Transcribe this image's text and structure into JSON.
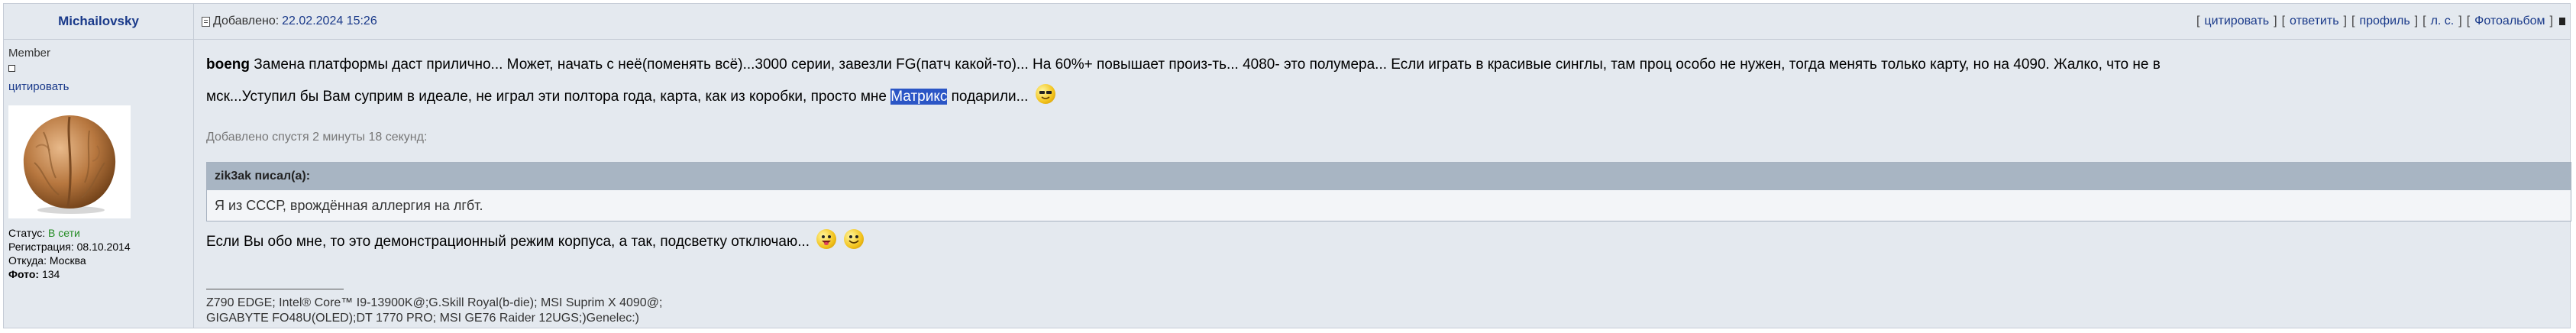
{
  "author": {
    "nick": "Michailovsky",
    "rank": "Member",
    "cite_label": "цитировать",
    "status_label": "Статус:",
    "status_value": "В сети",
    "reg_label": "Регистрация:",
    "reg_value": "08.10.2014",
    "from_label": "Откуда:",
    "from_value": "Москва",
    "photo_label": "Фото:",
    "photo_value": "134"
  },
  "header": {
    "added_label": "Добавлено:",
    "date": "22.02.2024 15:26",
    "actions": [
      "цитировать",
      "ответить",
      "профиль",
      "л. с.",
      "Фотоальбом"
    ]
  },
  "post": {
    "addressee": "boeng",
    "text1": "Замена платформы даст прилично... Может, начать с неё(поменять всё)...3000 серии, завезли FG(патч какой-то)... На 60%+ повышает произ-ть... 4080- это полумера... Если играть в красивые синглы, там проц особо не нужен, тогда менять только карту, но на 4090. Жалко, что не в",
    "text2_before": "мск...Уступил бы Вам суприм в идеале, не играл эти полтора года, карта, как из коробки, просто мне",
    "text2_sel": "Матрикс",
    "text2_after": "подарили...",
    "added_later": "Добавлено спустя 2 минуты 18 секунд:",
    "quote_author": "zik3ak писал(а):",
    "quote_text": "Я из СССР, врождённая аллергия на лгбт.",
    "text3": "Если Вы обо мне, то это демонстрационный режим корпуса, а так, подсветку отключаю...",
    "signature_line1": "Z790 EDGE; Intel® Core™ I9-13900K@;G.Skill Royal(b-die); MSI Suprim X 4090@;",
    "signature_line2": "GIGABYTE FO48U(OLED);DT 1770 PRO; MSI GE76 Raider 12UGS;)Genelec:)"
  },
  "icons": {
    "avatar": "walnut-avatar",
    "smileys": [
      "cool-smiley",
      "tongue-smiley",
      "grin-smiley"
    ],
    "post_link": "post-link-icon",
    "to_top": "to-top-icon"
  }
}
